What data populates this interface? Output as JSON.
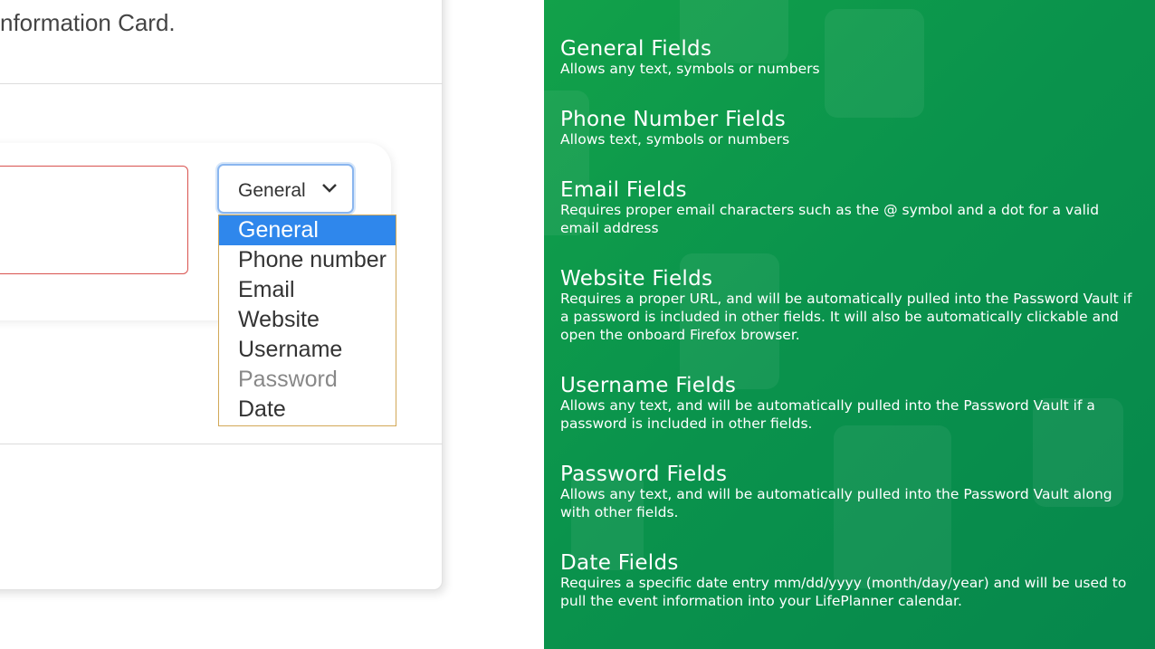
{
  "left_panel": {
    "card_heading": "nformation Card.",
    "field_type_select": {
      "selected_value": "General",
      "options": [
        {
          "label": "General",
          "state": "selected"
        },
        {
          "label": "Phone number",
          "state": "normal"
        },
        {
          "label": "Email",
          "state": "normal"
        },
        {
          "label": "Website",
          "state": "normal"
        },
        {
          "label": "Username",
          "state": "normal"
        },
        {
          "label": "Password",
          "state": "disabled"
        },
        {
          "label": "Date",
          "state": "normal"
        }
      ]
    },
    "colors": {
      "input_error_border": "#d9534f",
      "select_focus": "#8ab6ef",
      "option_highlight": "#2f87ec",
      "dropdown_border": "#d2a857"
    }
  },
  "right_panel": {
    "background_color": "#0a934c",
    "sections": [
      {
        "title": "General Fields",
        "description": "Allows any text, symbols or numbers"
      },
      {
        "title": "Phone Number Fields",
        "description": "Allows text, symbols or numbers"
      },
      {
        "title": "Email Fields",
        "description": "Requires proper email characters such as the @ symbol and a dot for a valid email address"
      },
      {
        "title": "Website Fields",
        "description": "Requires a proper URL, and will be automatically pulled into the Password Vault if a password is included in other fields. It will also be automatically clickable and open the onboard Firefox browser."
      },
      {
        "title": "Username Fields",
        "description": "Allows any text, and will be automatically pulled into the Password Vault if a password is included in other fields."
      },
      {
        "title": "Password Fields",
        "description": "Allows any text, and will be automatically pulled into the Password Vault along with other fields."
      },
      {
        "title": "Date Fields",
        "description": "Requires a specific date entry mm/dd/yyyy (month/day/year) and will be used to pull the event information into your LifePlanner calendar."
      }
    ]
  }
}
